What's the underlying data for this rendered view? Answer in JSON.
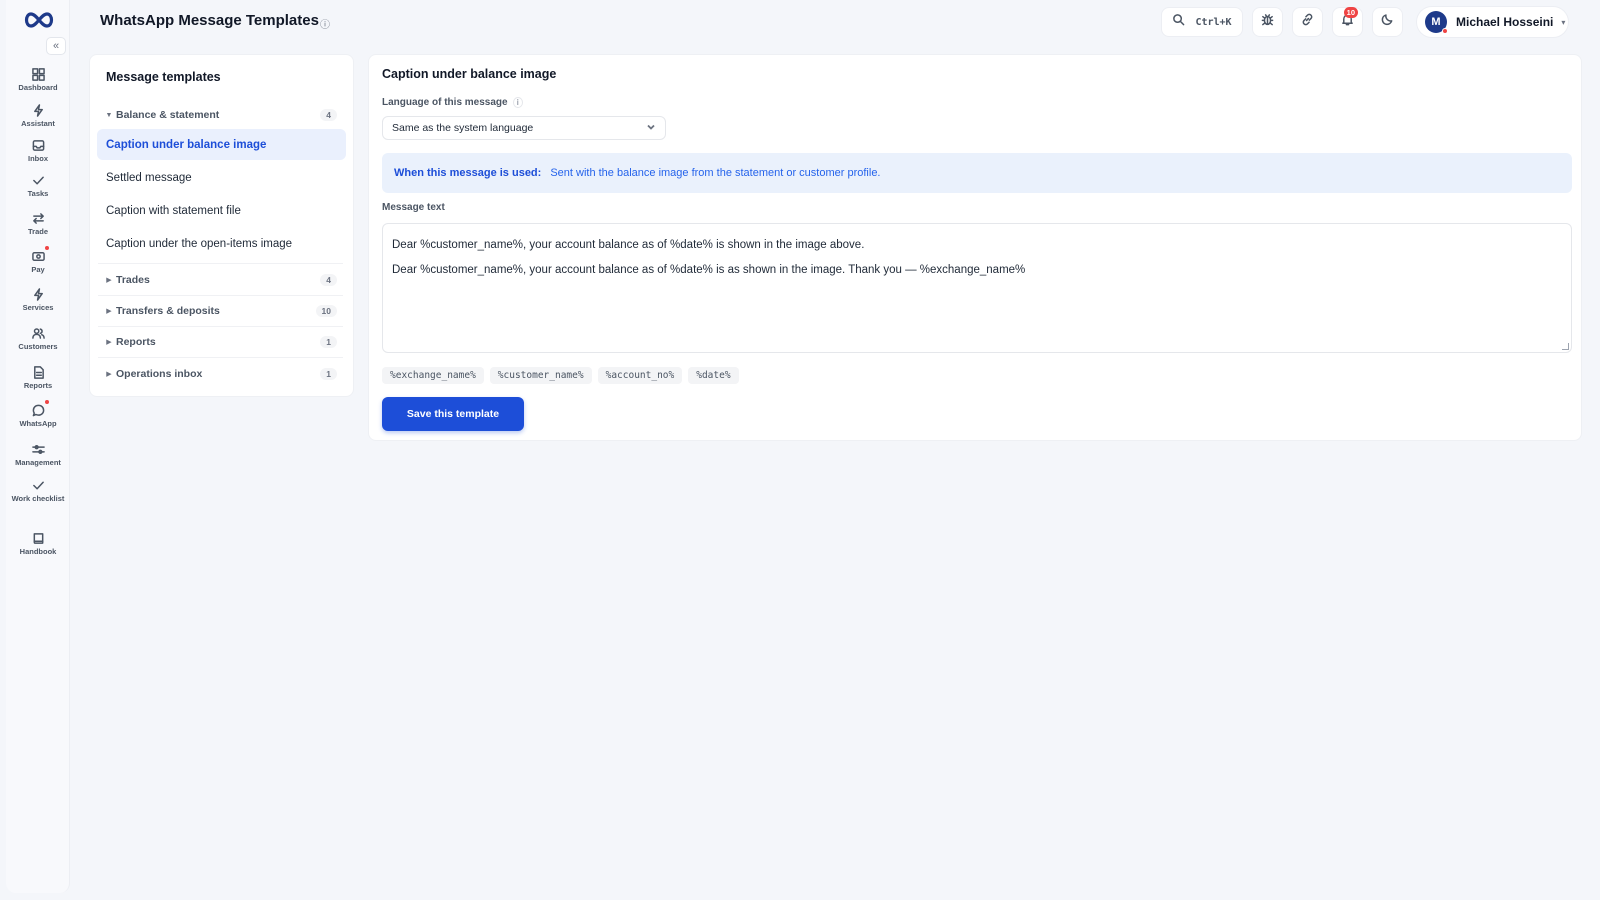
{
  "header": {
    "title": "WhatsApp Message Templates",
    "search_shortcut": "Ctrl+K",
    "notification_count": "10",
    "user": {
      "initial": "M",
      "name": "Michael Hosseini"
    }
  },
  "sidebar": {
    "items": [
      {
        "label": "Dashboard",
        "icon": "dashboard-icon"
      },
      {
        "label": "Assistant",
        "icon": "bolt-icon"
      },
      {
        "label": "Inbox",
        "icon": "inbox-icon"
      },
      {
        "label": "Tasks",
        "icon": "check-icon"
      },
      {
        "label": "Trade",
        "icon": "swap-icon"
      },
      {
        "label": "Pay",
        "icon": "cash-icon"
      },
      {
        "label": "Services",
        "icon": "bolt-icon"
      },
      {
        "label": "Customers",
        "icon": "users-icon"
      },
      {
        "label": "Reports",
        "icon": "file-icon"
      },
      {
        "label": "WhatsApp",
        "icon": "chat-icon"
      },
      {
        "label": "Management",
        "icon": "sliders-icon"
      },
      {
        "label": "Work checklist",
        "icon": "check-icon"
      },
      {
        "label": "Handbook",
        "icon": "book-icon"
      }
    ]
  },
  "templates_panel": {
    "title": "Message templates",
    "groups": [
      {
        "label": "Balance & statement",
        "count": "4",
        "expanded": true
      },
      {
        "label": "Trades",
        "count": "4"
      },
      {
        "label": "Transfers & deposits",
        "count": "10"
      },
      {
        "label": "Reports",
        "count": "1"
      },
      {
        "label": "Operations inbox",
        "count": "1"
      }
    ],
    "items": [
      {
        "label": "Caption under balance image",
        "active": true
      },
      {
        "label": "Settled message"
      },
      {
        "label": "Caption with statement file"
      },
      {
        "label": "Caption under the open-items image"
      }
    ]
  },
  "editor": {
    "title": "Caption under balance image",
    "language_label": "Language of this message",
    "language_value": "Same as the system language",
    "usage_label": "When this message is used:",
    "usage_text": "Sent with the balance image from the statement or customer profile.",
    "message_label": "Message text",
    "message_lines": [
      "Dear %customer_name%, your account balance as of %date% is shown in the image above.",
      "Dear %customer_name%, your account balance as of %date% is as shown in the image. Thank you — %exchange_name%"
    ],
    "placeholders": [
      "%exchange_name%",
      "%customer_name%",
      "%account_no%",
      "%date%"
    ],
    "save_label": "Save this template"
  },
  "colors": {
    "accent": "#1d4ed8",
    "background": "#f4f6fa",
    "badge": "#ef4444"
  }
}
